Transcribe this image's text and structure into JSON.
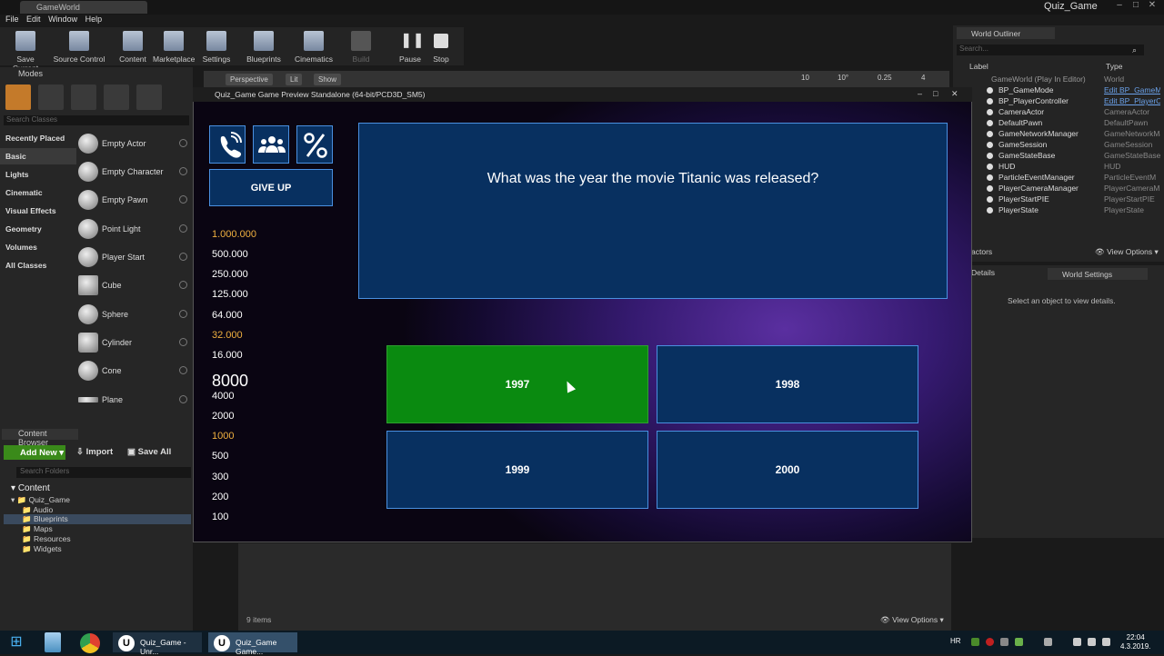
{
  "window": {
    "tab": "GameWorld",
    "title": "Quiz_Game"
  },
  "menu": [
    "File",
    "Edit",
    "Window",
    "Help"
  ],
  "toolbar": [
    "Save Current",
    "Source Control",
    "Content",
    "Marketplace",
    "Settings",
    "Blueprints",
    "Cinematics",
    "Build",
    "Pause",
    "Stop"
  ],
  "modes": {
    "title": "Modes",
    "search_placeholder": "Search Classes",
    "categories": [
      "Recently Placed",
      "Basic",
      "Lights",
      "Cinematic",
      "Visual Effects",
      "Geometry",
      "Volumes",
      "All Classes"
    ],
    "items": [
      "Empty Actor",
      "Empty Character",
      "Empty Pawn",
      "Point Light",
      "Player Start",
      "Cube",
      "Sphere",
      "Cylinder",
      "Cone",
      "Plane"
    ]
  },
  "content_browser": {
    "title": "Content Browser",
    "add_new": "Add New",
    "import": "Import",
    "save_all": "Save All",
    "search_placeholder": "Search Folders",
    "tree": [
      "Content",
      "Quiz_Game",
      "Audio",
      "Blueprints",
      "Maps",
      "Resources",
      "Widgets"
    ],
    "items_count": "9 items",
    "view_options": "View Options"
  },
  "viewport": {
    "perspective": "Perspective",
    "lit": "Lit",
    "show": "Show",
    "grid": "10",
    "angle": "10°",
    "scale": "0.25",
    "cams": "4"
  },
  "outliner": {
    "title": "World Outliner",
    "search_placeholder": "Search...",
    "col_label": "Label",
    "col_type": "Type",
    "actors": "actors",
    "view_options": "View Options",
    "rows": [
      {
        "label": "GameWorld (Play In Editor)",
        "type": "World"
      },
      {
        "label": "BP_GameMode",
        "type": "Edit BP_GameM"
      },
      {
        "label": "BP_PlayerController",
        "type": "Edit BP_PlayerC"
      },
      {
        "label": "CameraActor",
        "type": "CameraActor"
      },
      {
        "label": "DefaultPawn",
        "type": "DefaultPawn"
      },
      {
        "label": "GameNetworkManager",
        "type": "GameNetworkMa"
      },
      {
        "label": "GameSession",
        "type": "GameSession"
      },
      {
        "label": "GameStateBase",
        "type": "GameStateBase"
      },
      {
        "label": "HUD",
        "type": "HUD"
      },
      {
        "label": "ParticleEventManager",
        "type": "ParticleEventM"
      },
      {
        "label": "PlayerCameraManager",
        "type": "PlayerCameraM"
      },
      {
        "label": "PlayerStartPIE",
        "type": "PlayerStartPIE"
      },
      {
        "label": "PlayerState",
        "type": "PlayerState"
      }
    ]
  },
  "details": {
    "tab": "Details",
    "world_settings": "World Settings",
    "message": "Select an object to view details."
  },
  "game": {
    "window_title": "Quiz_Game Game Preview Standalone (64-bit/PCD3D_SM5)",
    "give_up": "GIVE UP",
    "prizes": [
      "1.000.000",
      "500.000",
      "250.000",
      "125.000",
      "64.000",
      "32.000",
      "16.000",
      "8000",
      "4000",
      "2000",
      "1000",
      "500",
      "300",
      "200",
      "100"
    ],
    "question": "What was the year the movie Titanic was released?",
    "answers": [
      "1997",
      "1998",
      "1999",
      "2000"
    ],
    "selected_answer": "1997"
  },
  "taskbar": {
    "app1": "Quiz_Game - Unr...",
    "app2": "Quiz_Game Game...",
    "lang": "HR",
    "time": "22:04",
    "date": "4.3.2019."
  },
  "colors": {
    "answer_bg": "#083060",
    "answer_border": "#4a90e0",
    "selected": "#0a8a10",
    "milestone": "#f0b040"
  }
}
